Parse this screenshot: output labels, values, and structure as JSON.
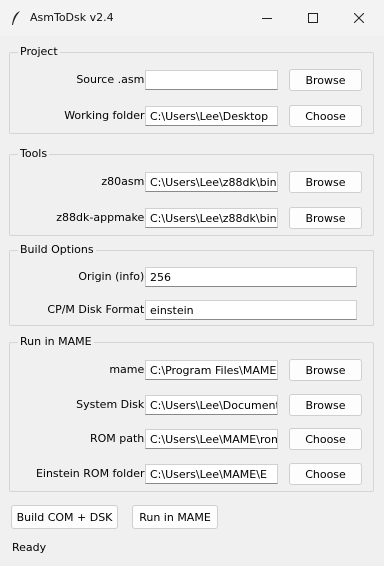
{
  "window": {
    "title": "AsmToDsk v2.4"
  },
  "project": {
    "label": "Project",
    "source": {
      "label": "Source .asm:",
      "value": "",
      "button": "Browse"
    },
    "working": {
      "label": "Working folder:",
      "value": "C:\\Users\\Lee\\Desktop",
      "button": "Choose"
    }
  },
  "tools": {
    "label": "Tools",
    "z80asm": {
      "label": "z80asm:",
      "value": "C:\\Users\\Lee\\z88dk\\bin",
      "button": "Browse"
    },
    "appmake": {
      "label": "z88dk-appmake:",
      "value": "C:\\Users\\Lee\\z88dk\\bin",
      "button": "Browse"
    }
  },
  "build": {
    "label": "Build Options",
    "origin": {
      "label": "Origin (info):",
      "value": "256"
    },
    "format": {
      "label": "CP/M Disk Format:",
      "value": "einstein"
    }
  },
  "mame": {
    "label": "Run in MAME",
    "mame": {
      "label": "mame:",
      "value": "C:\\Program Files\\MAME",
      "button": "Browse"
    },
    "disk": {
      "label": "System Disk:",
      "value": "C:\\Users\\Lee\\Documents",
      "button": "Browse"
    },
    "rom": {
      "label": "ROM path:",
      "value": "C:\\Users\\Lee\\MAME\\roms",
      "button": "Choose"
    },
    "einstein": {
      "label": "Einstein ROM folder:",
      "value": "C:\\Users\\Lee\\MAME\\E",
      "button": "Choose"
    }
  },
  "actions": {
    "build": "Build COM + DSK",
    "run": "Run in MAME"
  },
  "status": "Ready"
}
